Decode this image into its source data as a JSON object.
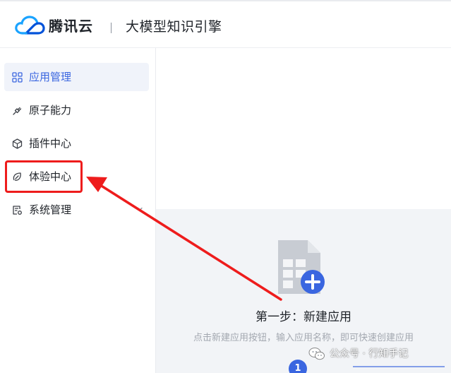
{
  "header": {
    "brand": "腾讯云",
    "product": "大模型知识引擎"
  },
  "sidebar": {
    "items": [
      {
        "label": "应用管理",
        "icon": "grid-icon",
        "active": true
      },
      {
        "label": "原子能力",
        "icon": "plug-icon",
        "active": false
      },
      {
        "label": "插件中心",
        "icon": "cube-icon",
        "active": false
      },
      {
        "label": "体验中心",
        "icon": "leaf-icon",
        "active": false
      },
      {
        "label": "系统管理",
        "icon": "settings-doc-icon",
        "active": false
      }
    ]
  },
  "empty_state": {
    "title": "第一步：新建应用",
    "description": "点击新建应用按钮，输入应用名称，即可快速创建应用",
    "step_number": "1",
    "icon": "new-doc-icon"
  },
  "watermark": {
    "text": "公众号 · 行知手记",
    "icon": "wechat-icon"
  },
  "colors": {
    "accent": "#3a66e0",
    "annotation": "#ee1c1c",
    "active_bg": "#f0f3fa",
    "content_bg": "#f2f4f7"
  }
}
